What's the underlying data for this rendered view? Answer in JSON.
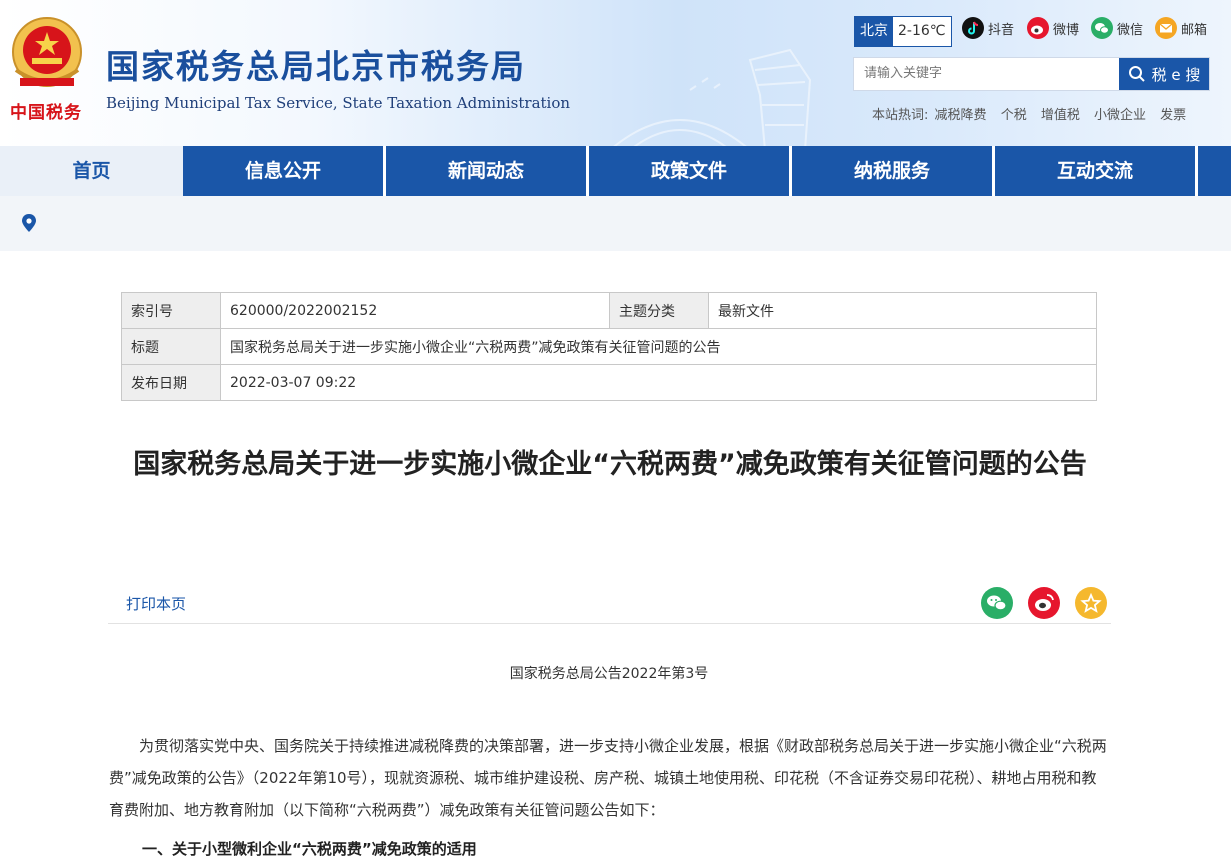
{
  "header": {
    "emblem_text": "中国税务",
    "title": "国家税务总局北京市税务局",
    "subtitle": "Beijing Municipal Tax Service, State Taxation Administration"
  },
  "weather": {
    "city": "北京",
    "temp": "2-16℃"
  },
  "social": [
    {
      "icon": "douyin-icon",
      "label": "抖音",
      "color": "#111111"
    },
    {
      "icon": "weibo-icon",
      "label": "微博",
      "color": "#e6162d"
    },
    {
      "icon": "wechat-icon",
      "label": "微信",
      "color": "#2aae67"
    },
    {
      "icon": "mail-icon",
      "label": "邮箱",
      "color": "#f5a623"
    }
  ],
  "search": {
    "placeholder": "请输入关键字",
    "button_label": "税 e 搜"
  },
  "hotwords": {
    "label": "本站热词:",
    "items": [
      "减税降费",
      "个税",
      "增值税",
      "小微企业",
      "发票"
    ]
  },
  "nav": [
    "首页",
    "信息公开",
    "新闻动态",
    "政策文件",
    "纳税服务",
    "互动交流"
  ],
  "meta": {
    "index_label": "索引号",
    "index_value": "620000/2022002152",
    "topic_label": "主题分类",
    "topic_value": "最新文件",
    "title_label": "标题",
    "title_value": "国家税务总局关于进一步实施小微企业“六税两费”减免政策有关征管问题的公告",
    "date_label": "发布日期",
    "date_value": "2022-03-07 09:22"
  },
  "article": {
    "title": "国家税务总局关于进一步实施小微企业“六税两费”减免政策有关征管问题的公告",
    "print_label": "打印本页",
    "doc_number": "国家税务总局公告2022年第3号",
    "paragraph1": "为贯彻落实党中央、国务院关于持续推进减税降费的决策部署，进一步支持小微企业发展，根据《财政部税务总局关于进一步实施小微企业“六税两费”减免政策的公告》（2022年第10号），现就资源税、城市维护建设税、房产税、城镇土地使用税、印花税（不含证券交易印花税）、耕地占用税和教育费附加、地方教育附加（以下简称“六税两费”）减免政策有关征管问题公告如下：",
    "section1": "一、关于小型微利企业“六税两费”减免政策的适用"
  },
  "colors": {
    "brand_blue": "#1a56a8",
    "title_blue": "#1a4f9d",
    "emblem_red": "#d7141a"
  }
}
